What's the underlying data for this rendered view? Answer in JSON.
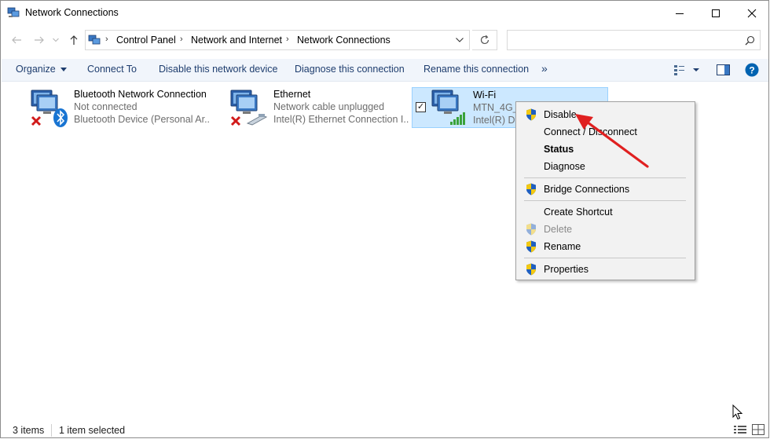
{
  "window": {
    "title": "Network Connections"
  },
  "address": {
    "breadcrumbs": [
      "Control Panel",
      "Network and Internet",
      "Network Connections"
    ],
    "search_placeholder": ""
  },
  "toolbar": {
    "organize": "Organize",
    "connect_to": "Connect To",
    "disable_device": "Disable this network device",
    "diagnose": "Diagnose this connection",
    "rename": "Rename this connection",
    "more": "»"
  },
  "items": [
    {
      "name": "Bluetooth Network Connection",
      "status": "Not connected",
      "device": "Bluetooth Device (Personal Ar..."
    },
    {
      "name": "Ethernet",
      "status": "Network cable unplugged",
      "device": "Intel(R) Ethernet Connection I..."
    },
    {
      "name": "Wi-Fi",
      "status": "MTN_4G_2",
      "device": "Intel(R) Du"
    }
  ],
  "context_menu": {
    "items": [
      {
        "label": "Disable",
        "shield": true,
        "bold": false,
        "disabled": false
      },
      {
        "label": "Connect / Disconnect",
        "shield": false,
        "bold": false,
        "disabled": false
      },
      {
        "label": "Status",
        "shield": false,
        "bold": true,
        "disabled": false
      },
      {
        "label": "Diagnose",
        "shield": false,
        "bold": false,
        "disabled": false
      },
      {
        "label": "Bridge Connections",
        "shield": true,
        "bold": false,
        "disabled": false
      },
      {
        "label": "Create Shortcut",
        "shield": false,
        "bold": false,
        "disabled": false
      },
      {
        "label": "Delete",
        "shield": true,
        "bold": false,
        "disabled": true
      },
      {
        "label": "Rename",
        "shield": true,
        "bold": false,
        "disabled": false
      },
      {
        "label": "Properties",
        "shield": true,
        "bold": false,
        "disabled": false
      }
    ]
  },
  "status_bar": {
    "count": "3 items",
    "selected": "1 item selected"
  },
  "icons": {
    "title": "network-connections-icon",
    "back": "back-arrow-icon",
    "forward": "forward-arrow-icon",
    "recent": "chevron-down-icon",
    "up": "up-arrow-icon",
    "refresh": "refresh-icon",
    "search": "search-icon",
    "help": "help-icon"
  },
  "colors": {
    "accent": "#0063b1",
    "selection": "#cce8ff",
    "arrow": "#e02020",
    "error_x": "#d11a1a"
  }
}
